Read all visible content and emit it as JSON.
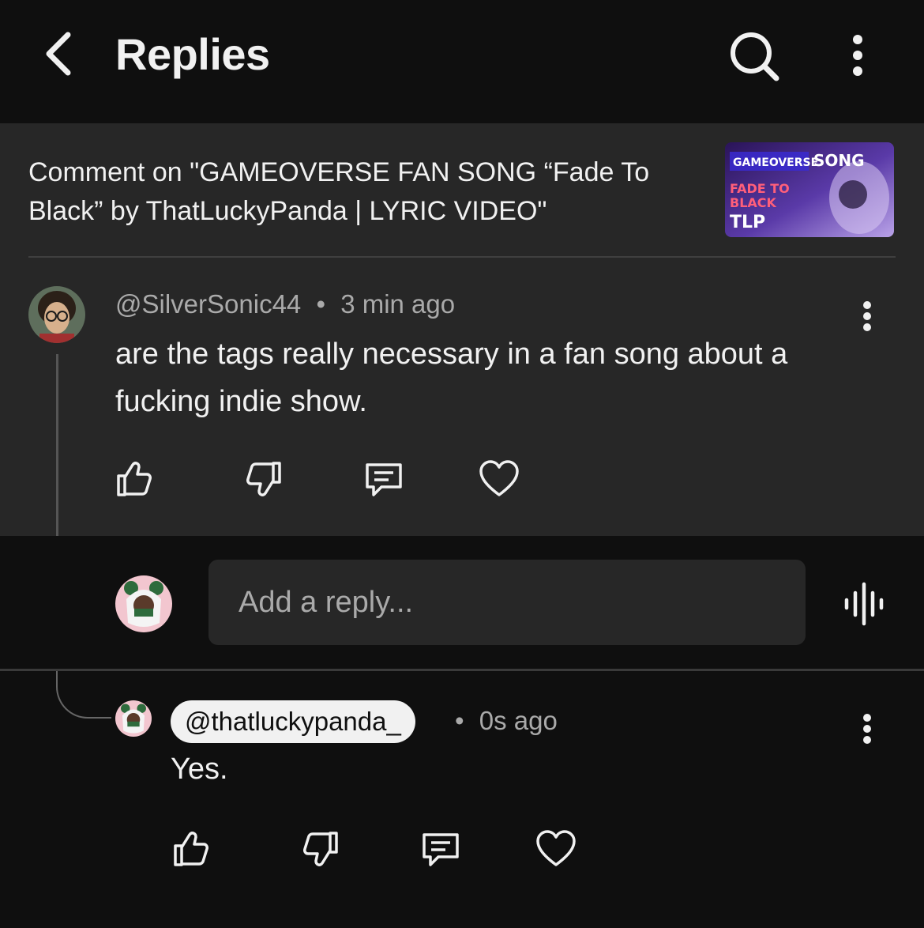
{
  "header": {
    "title": "Replies"
  },
  "context": {
    "text": "Comment on \"GAMEOVERSE FAN SONG “Fade To Black” by ThatLuckyPanda | LYRIC VIDEO\""
  },
  "thumbnail": {
    "logo": "GAMEOVERSE",
    "tag": "SONG",
    "line1": "FADE TO",
    "line2": "BLACK",
    "line3": "TLP"
  },
  "parent_comment": {
    "author": "@SilverSonic44",
    "separator": "•",
    "time": "3 min ago",
    "text": "are the tags really necessary in a fan song about a fucking indie show."
  },
  "reply_box": {
    "placeholder": "Add a reply..."
  },
  "reply": {
    "mention": "@thatluckypanda_",
    "separator": "•",
    "time": "0s ago",
    "text": "Yes."
  },
  "icons": [
    "back-arrow-icon",
    "search-icon",
    "more-vert-icon",
    "thumbs-up-icon",
    "thumbs-down-icon",
    "reply-comment-icon",
    "heart-icon",
    "voice-input-icon"
  ],
  "colors": {
    "background": "#0f0f0f",
    "panel": "#272727",
    "text": "#f1f1f1",
    "muted": "#aaaaaa"
  }
}
